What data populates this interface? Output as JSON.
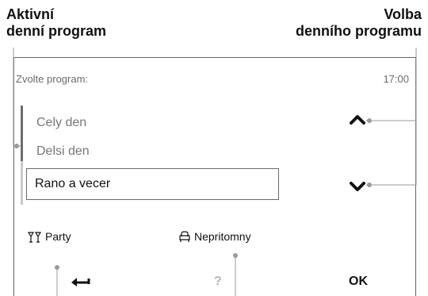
{
  "callouts": {
    "active_line1": "Aktivní",
    "active_line2": "denní program",
    "choice_line1": "Volba",
    "choice_line2": "denního programu"
  },
  "screen": {
    "title": "Zvolte program:",
    "time": "17:00",
    "programs": [
      "Cely den",
      "Delsi den",
      "Rano a vecer"
    ],
    "selected_index": 2
  },
  "softkeys": {
    "party_label": "Party",
    "absent_label": "Nepritomny",
    "help_label": "?",
    "ok_label": "OK"
  },
  "icons": {
    "party": "cocktail-glasses-icon",
    "absent": "armchair-icon",
    "up": "chevron-up-icon",
    "down": "chevron-down-icon",
    "back": "back-arrow-icon"
  }
}
